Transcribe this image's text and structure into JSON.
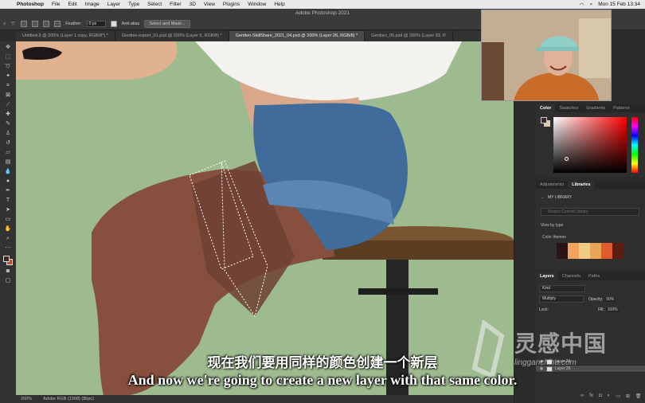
{
  "menubar": {
    "app_name": "Photoshop",
    "items": [
      "File",
      "Edit",
      "Image",
      "Layer",
      "Type",
      "Select",
      "Filter",
      "3D",
      "View",
      "Plugins",
      "Window",
      "Help"
    ],
    "datetime": "Mon 15 Feb  13:34"
  },
  "window": {
    "title": "Adobe Photoshop 2021"
  },
  "options": {
    "feather_label": "Feather:",
    "feather_value": "0 px",
    "anti_alias_label": "Anti-alias",
    "select_mask_label": "Select and Mask..."
  },
  "tabs": [
    {
      "label": "Untitled-3 @ 200% (Layer 1 copy, RGB/8*) *",
      "active": false
    },
    {
      "label": "Gerdien-export_01.psd @ 200% (Layer 5, RGB/8) *",
      "active": false
    },
    {
      "label": "Gerdien-SkillShare_2021_04.psd @ 200% (Layer 26, RGB/8) *",
      "active": true
    },
    {
      "label": "Gerdien_05.psd @ 200% (Layer 39, R",
      "active": false
    }
  ],
  "status": {
    "zoom": "200%",
    "profile": "Adobe RGB (1998) (8bpc)"
  },
  "color_panel": {
    "tabs": [
      "Color",
      "Swatches",
      "Gradients",
      "Patterns"
    ]
  },
  "libraries_panel": {
    "tabs": [
      "Adjustments",
      "Libraries"
    ],
    "library_name": "MY LIBRARY",
    "search_placeholder": "Search Current Library",
    "view_by": "View by type",
    "section": "Color themes",
    "theme_colors": [
      "#2a1414",
      "#f2a35e",
      "#f0cd83",
      "#e8a654",
      "#e05a2d",
      "#5a1d14"
    ]
  },
  "layers_panel": {
    "tabs": [
      "Layers",
      "Channels",
      "Paths"
    ],
    "kind_label": "Kind",
    "blend_mode": "Multiply",
    "opacity_label": "Opacity:",
    "opacity_value": "50%",
    "lock_label": "Lock:",
    "fill_label": "Fill:",
    "fill_value": "100%",
    "layers": [
      {
        "name": "Layer 24",
        "active": false
      },
      {
        "name": "Layer 26",
        "active": true
      }
    ]
  },
  "subtitles": {
    "zh": "现在我们要用同样的颜色创建一个新层",
    "en": "And now we're going to create a new layer with that same color."
  },
  "watermark": {
    "text": "灵感中国",
    "url": "lingganchina.com"
  },
  "colors": {
    "canvas_bg": "#9dbb8e",
    "foreground": "#3d2a24",
    "background": "#c24d2c"
  }
}
